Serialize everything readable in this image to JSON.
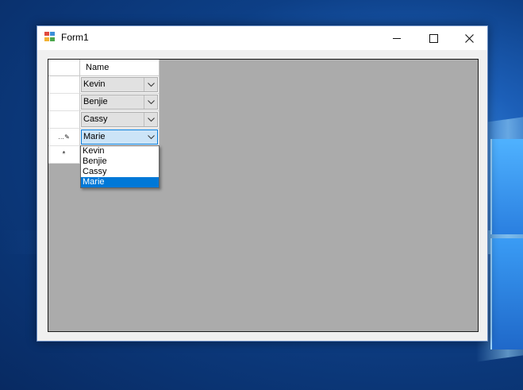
{
  "window": {
    "title": "Form1",
    "controls": {
      "minimize": "minimize",
      "maximize": "maximize",
      "close": "close"
    }
  },
  "grid": {
    "columns": [
      "Name"
    ],
    "rows": [
      {
        "header_icon": "",
        "value": "Kevin"
      },
      {
        "header_icon": "",
        "value": "Benjie"
      },
      {
        "header_icon": "",
        "value": "Cassy"
      },
      {
        "header_icon": "pencil-icon",
        "value": "Marie"
      }
    ],
    "new_row_icon": "asterisk-icon",
    "new_row_glyph": "*",
    "editing_glyph": "…✎"
  },
  "dropdown": {
    "options": [
      "Kevin",
      "Benjie",
      "Cassy",
      "Marie"
    ],
    "selected_index": 3
  },
  "colors": {
    "selection": "#0078d7",
    "grid_background": "#ababab",
    "active_combo": "#cce4f7"
  }
}
